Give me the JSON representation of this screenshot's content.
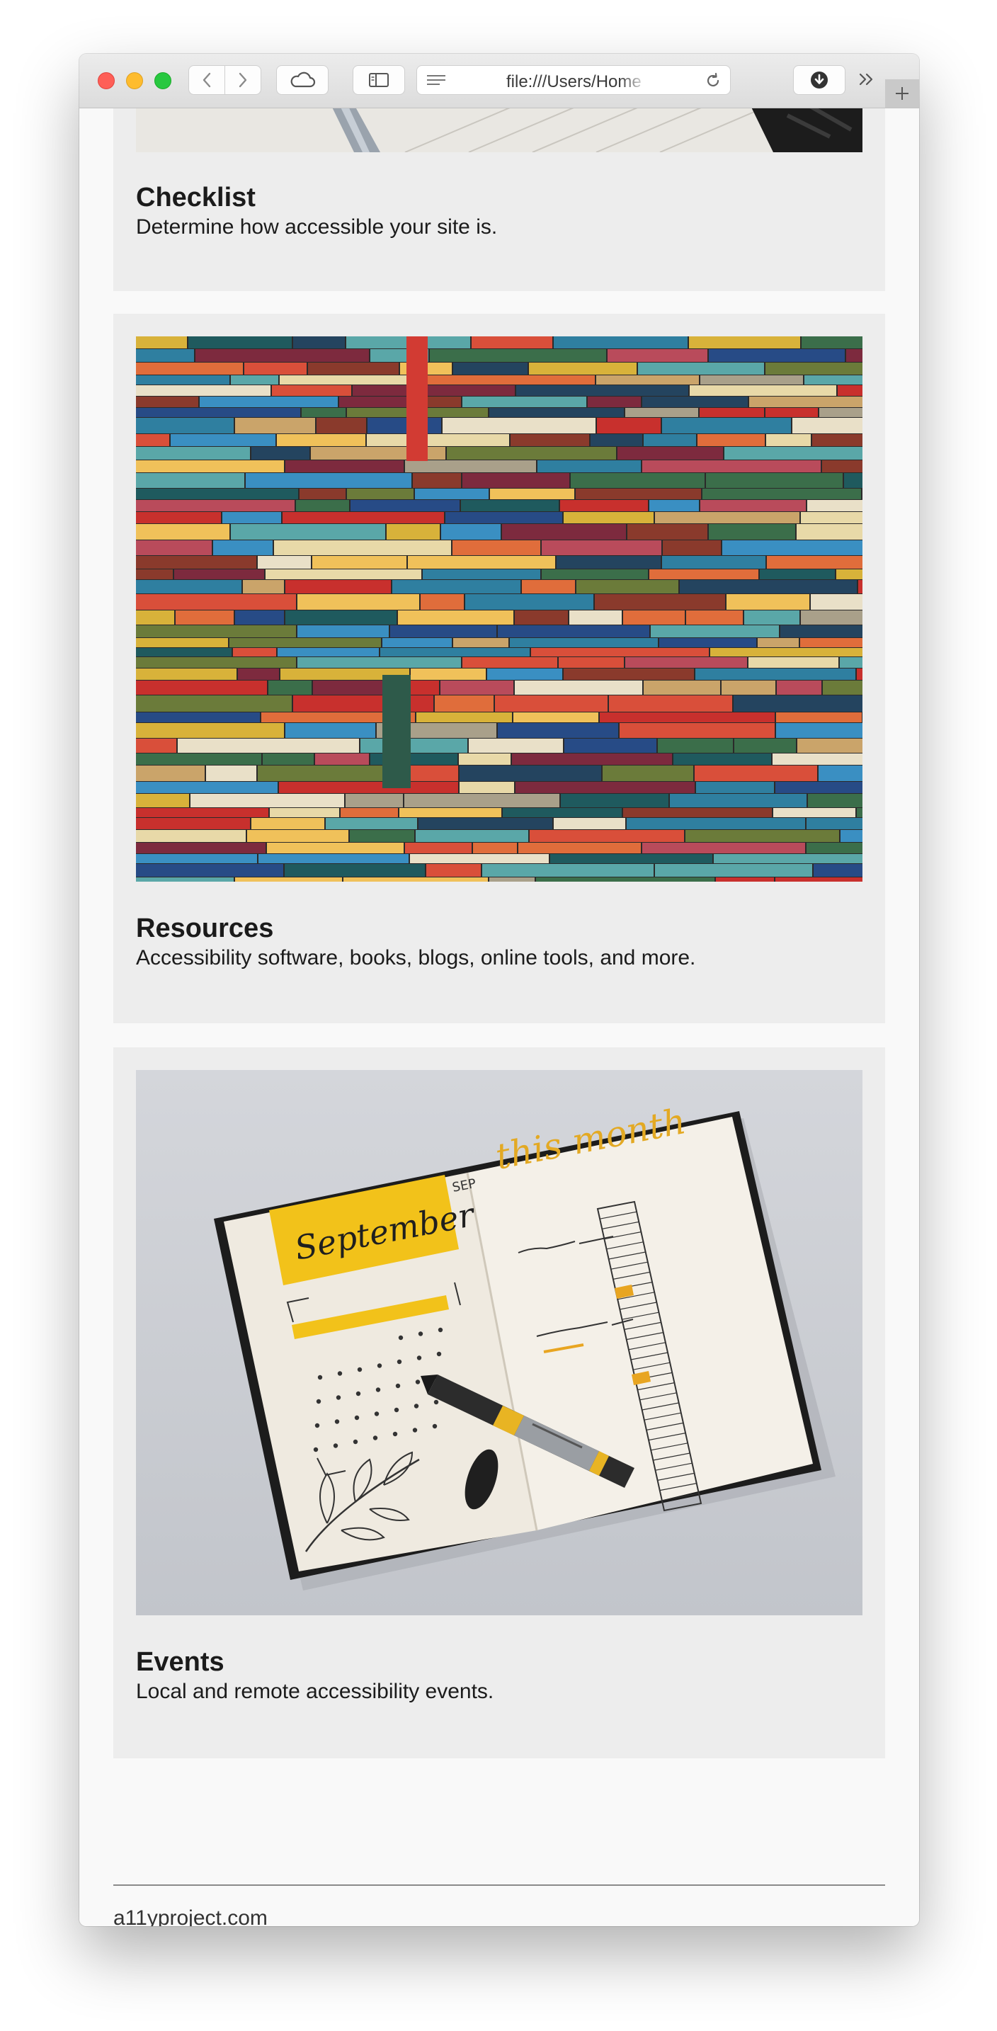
{
  "browser": {
    "url": "file:///Users/Home",
    "icons": {
      "back": "chevron-left-icon",
      "forward": "chevron-right-icon",
      "cloud": "cloud-icon",
      "sidebar": "sidebar-icon",
      "reader": "reader-list-icon",
      "reload": "reload-icon",
      "download": "download-icon",
      "more": "double-chevron-icon",
      "new_tab": "plus-icon"
    }
  },
  "cards": [
    {
      "title": "Checklist",
      "description": "Determine how accessible your site is.",
      "image": "pen-and-notebook-photo"
    },
    {
      "title": "Resources",
      "description": "Accessibility software, books, blogs, online tools, and more.",
      "image": "stacked-colorful-books-photo"
    },
    {
      "title": "Events",
      "description": "Local and remote accessibility events.",
      "image": "bullet-journal-september-photo",
      "image_text": {
        "month": "September",
        "heading": "this month",
        "sep": "SEP"
      }
    }
  ],
  "footer": {
    "link": "a11yproject.com"
  },
  "colors": {
    "card_bg": "#ededed",
    "page_bg": "#f9f9f9",
    "journal_yellow": "#f2c21a"
  }
}
